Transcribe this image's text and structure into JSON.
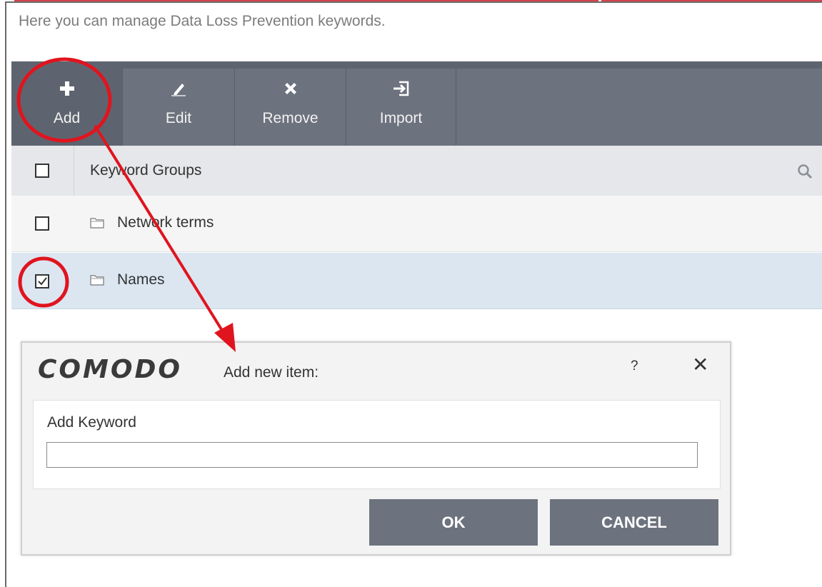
{
  "description": "Here you can manage Data Loss Prevention keywords.",
  "toolbar": {
    "buttons": [
      {
        "label": "Add",
        "icon": "plus-icon"
      },
      {
        "label": "Edit",
        "icon": "pencil-icon"
      },
      {
        "label": "Remove",
        "icon": "x-icon"
      },
      {
        "label": "Import",
        "icon": "import-icon"
      }
    ]
  },
  "table": {
    "header": "Keyword Groups",
    "rows": [
      {
        "name": "Network terms",
        "checked": false
      },
      {
        "name": "Names",
        "checked": true
      }
    ]
  },
  "dialog": {
    "brand": "COMODO",
    "title": "Add new item:",
    "help": "?",
    "close": "✕",
    "field_label": "Add Keyword",
    "field_value": "",
    "ok_label": "OK",
    "cancel_label": "CANCEL"
  },
  "colors": {
    "toolbar": "#6c727e",
    "selected_row": "#dbe6f1",
    "annotation": "#e0141e"
  }
}
